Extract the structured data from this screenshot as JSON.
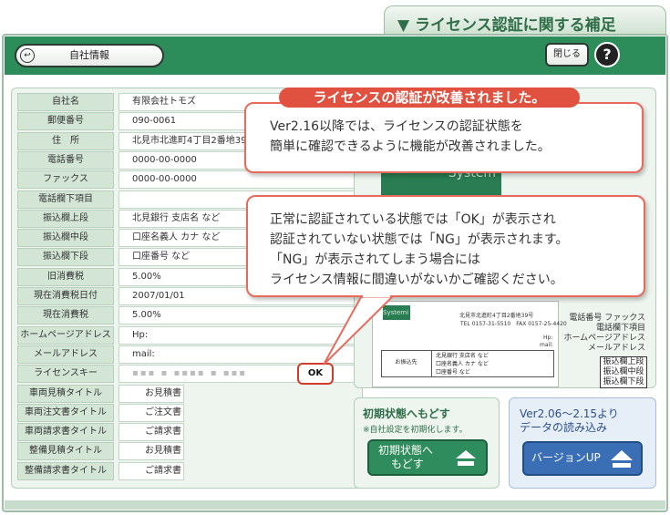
{
  "supplement_tab": {
    "label": "▼ ライセンス認証に関する補足"
  },
  "header": {
    "company_button_label": "自社情報",
    "close_button_label": "閉じる",
    "help_icon_glyph": "?"
  },
  "form": {
    "rows": [
      {
        "label": "自社名",
        "value": "有限会社トモズ"
      },
      {
        "label": "郵便番号",
        "value": "090-0061"
      },
      {
        "label": "住　所",
        "value": "北見市北進町4丁目2番地39"
      },
      {
        "label": "電話番号",
        "value": "0000-00-0000"
      },
      {
        "label": "ファックス",
        "value": "0000-00-0000"
      },
      {
        "label": "電話欄下項目",
        "value": ""
      },
      {
        "label": "振込欄上段",
        "value": "北見銀行 支店名 など"
      },
      {
        "label": "振込欄中段",
        "value": "口座名義人 カナ など"
      },
      {
        "label": "振込欄下段",
        "value": "口座番号 など"
      },
      {
        "label": "旧消費税",
        "value": "5.00%"
      },
      {
        "label": "現在消費税日付",
        "value": "2007/01/01"
      },
      {
        "label": "現在消費税",
        "value": "5.00%"
      },
      {
        "label": "ホームページアドレス",
        "value": "Hp:"
      },
      {
        "label": "メールアドレス",
        "value": "mail:"
      },
      {
        "label": "ライセンスキー",
        "value": "▪▪▪ ▪ ▪▪▪▪ ▪ ▪▪▪"
      },
      {
        "label": "車両見積タイトル",
        "value": "お見積書"
      },
      {
        "label": "車両注文書タイトル",
        "value": "ご注文書"
      },
      {
        "label": "車両請求書タイトル",
        "value": "ご請求書"
      },
      {
        "label": "整備見積タイトル",
        "value": "お見積書"
      },
      {
        "label": "整備請求書タイトル",
        "value": "ご請求書"
      }
    ],
    "license_status": "OK"
  },
  "preview": {
    "logo_text": "System",
    "small_logo_text": "Systemi",
    "address_line": "北見市北進町4丁目2番地39号",
    "tel_line": "TEL 0157-31-5510　FAX 0157-25-4420",
    "hp": "Hp:",
    "mail": "mail:",
    "box_head": "お振込先",
    "box_lines": [
      "北見銀行 支店名 など",
      "口座名義人 カナ など",
      "口座番号 など"
    ],
    "side_labels": [
      "電話番号 ファックス",
      "電話欄下項目",
      "ホームページアドレス",
      "メールアドレス"
    ],
    "bank_labels": [
      "振込欄上段",
      "振込欄中段",
      "振込欄下段"
    ]
  },
  "reset": {
    "title": "初期状態へもどす",
    "note": "※自社設定を初期化します。",
    "button_lines": [
      "初期状態へ",
      "もどす"
    ]
  },
  "version": {
    "title_lines": [
      "Ver2.06～2.15より",
      "データの読み込み"
    ],
    "button_label": "バージョンUP"
  },
  "callouts": {
    "banner": "ライセンスの認証が改善されました。",
    "first_lines": [
      "Ver2.16以降では、ライセンスの認証状態を",
      "簡単に確認できるように機能が改善されました。"
    ],
    "second_lines": [
      "正常に認証されている状態では「OK」が表示され",
      "認証されていない状態では「NG」が表示されます。",
      "「NG」が表示されてしまう場合には",
      "ライセンス情報に間違いがないかご確認ください。"
    ]
  },
  "colors": {
    "header_green": "#2c8c5a",
    "panel_green": "#eef5ef",
    "label_green": "#d3e6d6",
    "callout_red": "#e0513f",
    "version_blue": "#3a6fb5"
  }
}
